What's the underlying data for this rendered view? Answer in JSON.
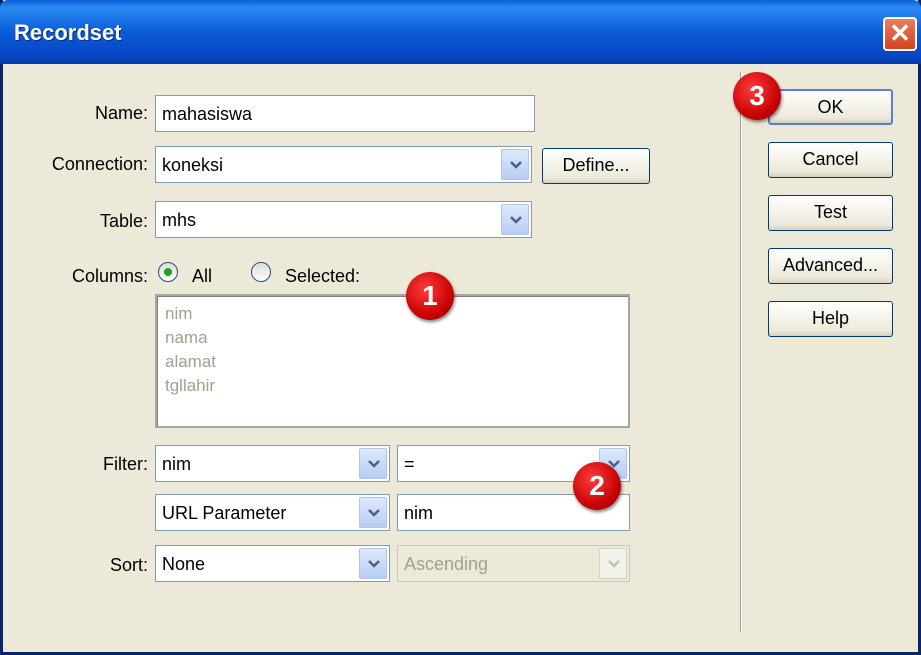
{
  "window": {
    "title": "Recordset",
    "close_glyph": "✕"
  },
  "form": {
    "name_label": "Name:",
    "name_value": "mahasiswa",
    "connection_label": "Connection:",
    "connection_value": "koneksi",
    "define_button": "Define...",
    "table_label": "Table:",
    "table_value": "mhs",
    "columns_label": "Columns:",
    "columns_all": "All",
    "columns_selected": "Selected:",
    "columns_list": [
      "nim",
      "nama",
      "alamat",
      "tgllahir"
    ],
    "filter_label": "Filter:",
    "filter_column": "nim",
    "filter_operator": "=",
    "filter_source": "URL Parameter",
    "filter_value": "nim",
    "sort_label": "Sort:",
    "sort_column": "None",
    "sort_order": "Ascending"
  },
  "buttons": {
    "ok": "OK",
    "cancel": "Cancel",
    "test": "Test",
    "advanced": "Advanced...",
    "help": "Help"
  },
  "badges": [
    "1",
    "2",
    "3"
  ]
}
